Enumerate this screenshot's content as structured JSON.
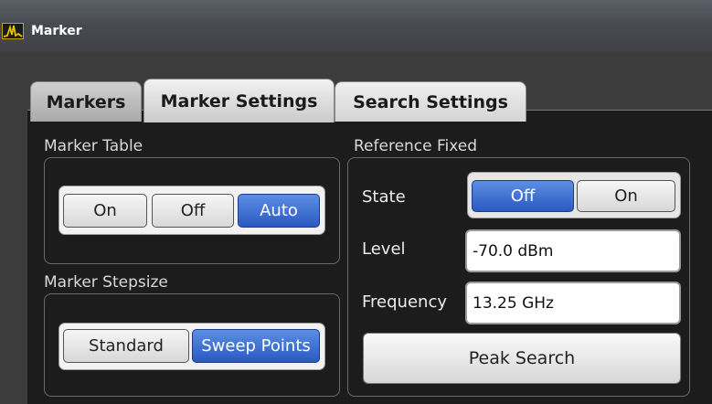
{
  "window": {
    "title": "Marker",
    "icon": "spectrum-app-icon"
  },
  "tabs": [
    {
      "label": "Markers",
      "active": false
    },
    {
      "label": "Marker Settings",
      "active": true
    },
    {
      "label": "Search Settings",
      "active": false
    }
  ],
  "marker_table": {
    "label": "Marker Table",
    "options": [
      "On",
      "Off",
      "Auto"
    ],
    "selected": "Auto"
  },
  "marker_stepsize": {
    "label": "Marker Stepsize",
    "options": [
      "Standard",
      "Sweep Points"
    ],
    "selected": "Sweep Points"
  },
  "reference_fixed": {
    "label": "Reference Fixed",
    "state_label": "State",
    "state_options": [
      "Off",
      "On"
    ],
    "state_selected": "Off",
    "level_label": "Level",
    "level_value": "-70.0 dBm",
    "frequency_label": "Frequency",
    "frequency_value": "13.25 GHz",
    "peak_search_label": "Peak Search"
  },
  "colors": {
    "selected_button": "#2b59c1",
    "background": "#1c1c1c",
    "titlebar": "#484b51"
  }
}
